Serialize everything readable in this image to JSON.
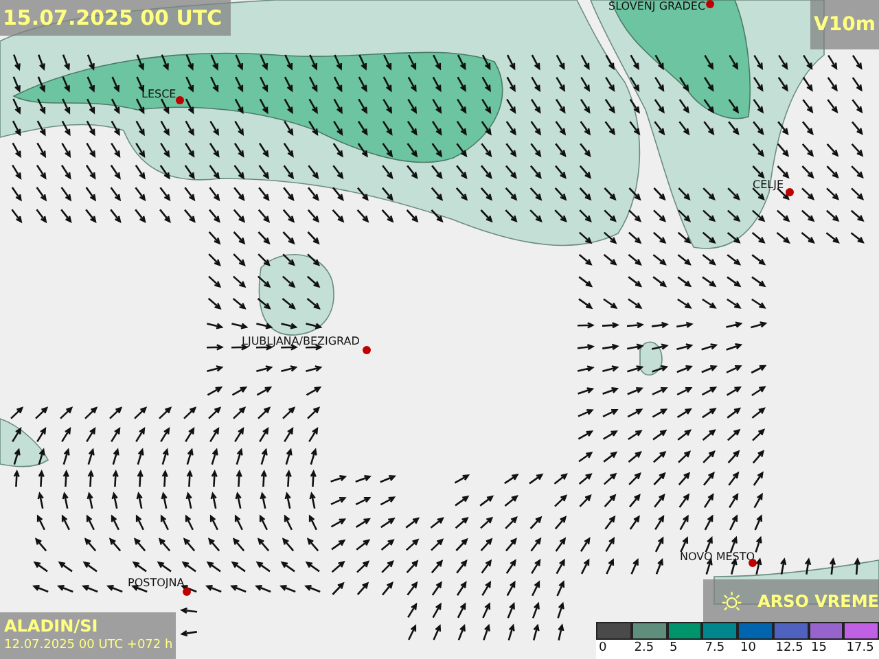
{
  "map": {
    "valid_time": "15.07.2025 00 UTC",
    "variable": "V10m",
    "cities": [
      {
        "name": "SLOVENJ GRADEC"
      },
      {
        "name": "LESCE"
      },
      {
        "name": "CELJE"
      },
      {
        "name": "LJUBLJANA/BEZIGRAD"
      },
      {
        "name": "NOVO MESTO"
      },
      {
        "name": "POSTOJNA"
      }
    ],
    "model": "ALADIN/SI",
    "run": "12.07.2025 00 UTC +072 h",
    "brand": "ARSO VREME",
    "legend": [
      {
        "label": "0",
        "color": "#4a4a4a"
      },
      {
        "label": "2.5",
        "color": "#5f8f7c"
      },
      {
        "label": "5",
        "color": "#00946c"
      },
      {
        "label": "7.5",
        "color": "#00868c"
      },
      {
        "label": "10",
        "color": "#0064ae"
      },
      {
        "label": "12.5",
        "color": "#5062c0"
      },
      {
        "label": "15",
        "color": "#9664cc"
      },
      {
        "label": "17.5",
        "color": "#c060e4"
      }
    ]
  }
}
